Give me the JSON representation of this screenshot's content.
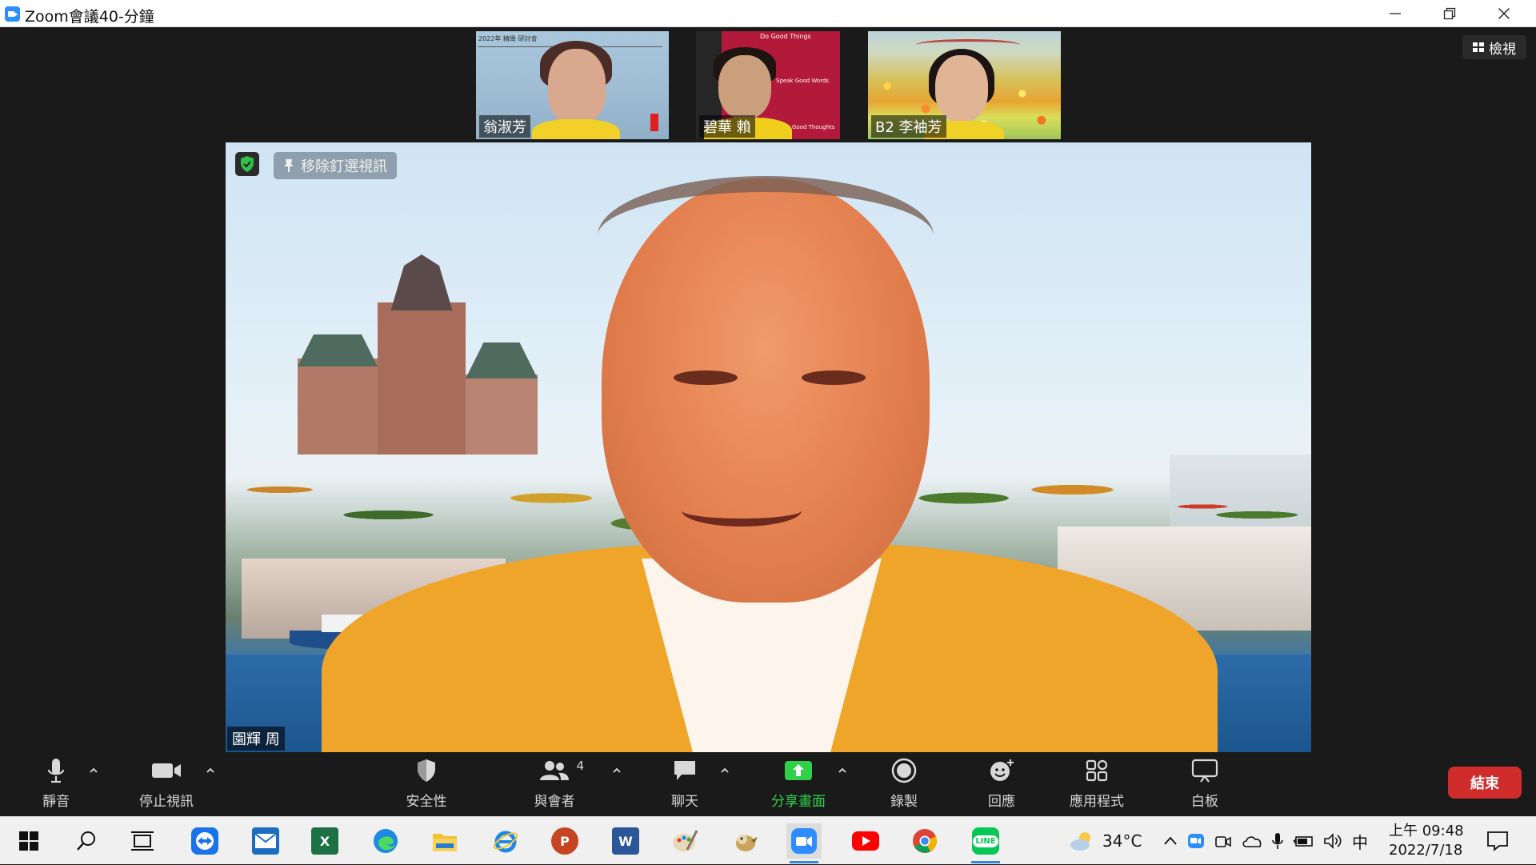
{
  "window": {
    "title": "Zoom會議40-分鐘",
    "app_icon": "zoom-icon",
    "controls": [
      "minimize-icon",
      "restore-icon",
      "close-icon"
    ]
  },
  "view_button": {
    "label": "檢視",
    "icon": "grid-view-icon"
  },
  "gallery": [
    {
      "name": "翁淑芳",
      "slide_text": "2022年 精緻 研討會"
    },
    {
      "name": "碧華 賴",
      "board_top": "Do Good Things",
      "board_mid": "Speak Good Words",
      "board_bottom": "Good Thoughts"
    },
    {
      "name": "B2 李袖芳"
    }
  ],
  "speaker": {
    "name": "園輝 周",
    "unpin_label": "移除釘選視訊",
    "shield_icon": "security-shield-icon",
    "pin_icon": "pin-icon"
  },
  "toolbar": {
    "mute": {
      "label": "靜音",
      "icon": "microphone-icon"
    },
    "video": {
      "label": "停止視訊",
      "icon": "video-camera-icon"
    },
    "security": {
      "label": "安全性",
      "icon": "shield-icon"
    },
    "participants": {
      "label": "與會者",
      "icon": "participants-icon",
      "count": "4"
    },
    "chat": {
      "label": "聊天",
      "icon": "chat-bubble-icon"
    },
    "share": {
      "label": "分享畫面",
      "icon": "share-screen-icon",
      "color": "#2fd14a"
    },
    "record": {
      "label": "錄製",
      "icon": "record-icon"
    },
    "reactions": {
      "label": "回應",
      "icon": "emoji-icon"
    },
    "apps": {
      "label": "應用程式",
      "icon": "apps-icon"
    },
    "whiteboard": {
      "label": "白板",
      "icon": "whiteboard-icon"
    },
    "end": {
      "label": "結束",
      "color": "#d12c2c"
    }
  },
  "taskbar": {
    "apps": [
      "windows-start-icon",
      "search-icon",
      "task-view-icon",
      "teamviewer-icon",
      "mail-icon",
      "excel-icon",
      "edge-icon",
      "file-explorer-icon",
      "internet-explorer-icon",
      "powerpoint-icon",
      "word-icon",
      "paint-icon",
      "app-bird-icon",
      "zoom-icon",
      "youtube-icon",
      "chrome-icon",
      "line-icon"
    ],
    "excel_letter": "X",
    "powerpoint_letter": "P",
    "word_letter": "W",
    "line_label": "LINE",
    "weather": "34°C",
    "ime": "中",
    "clock_time": "上午 09:48",
    "clock_date": "2022/7/18"
  }
}
